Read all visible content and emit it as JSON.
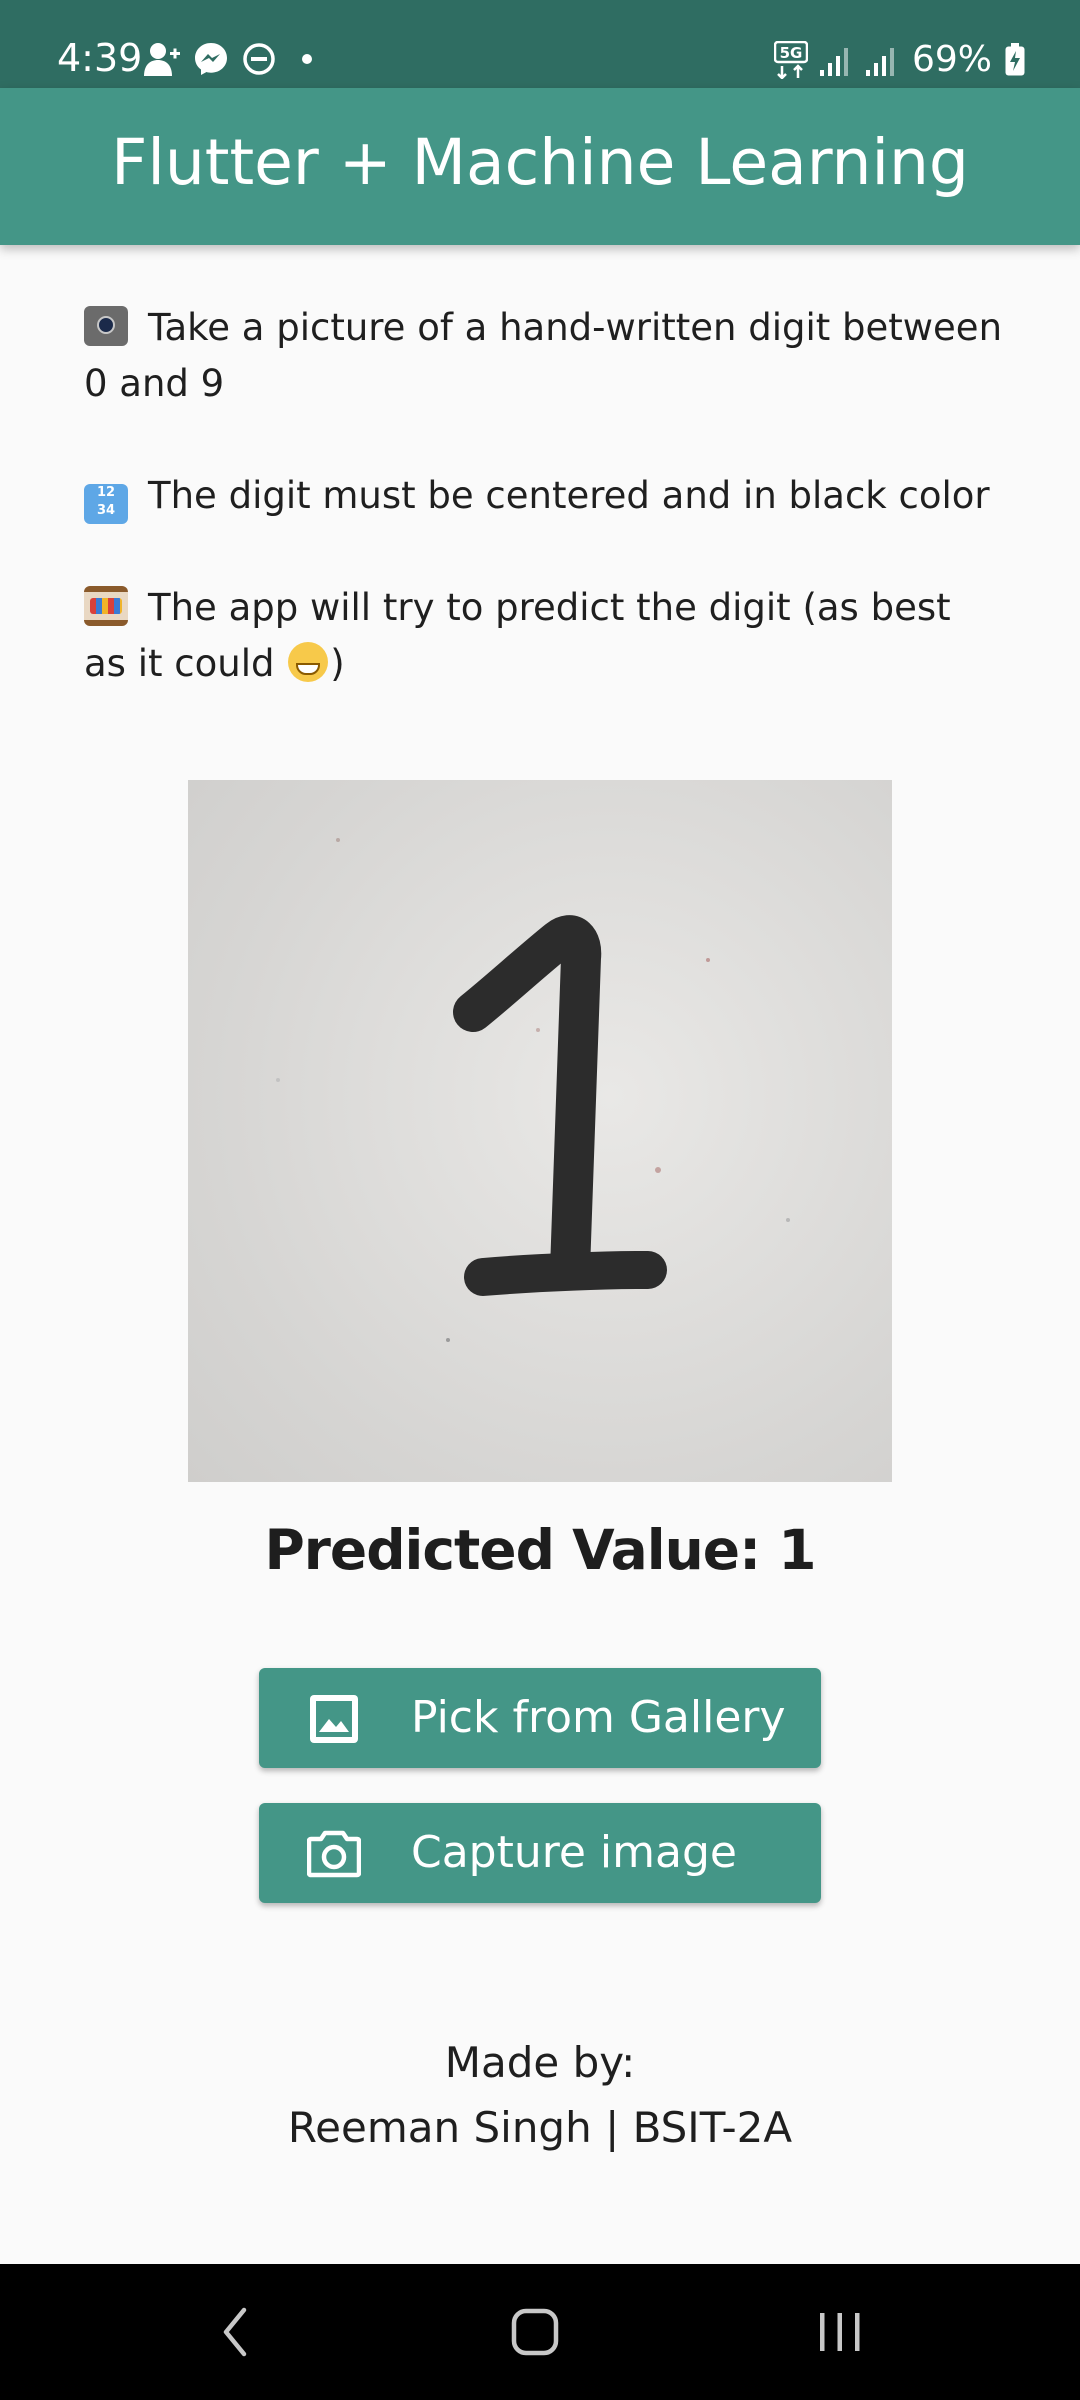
{
  "status_bar": {
    "time": "4:39",
    "network": "5G",
    "battery": "69%",
    "icons": [
      "add-person-icon",
      "messenger-icon",
      "do-not-disturb-icon",
      "notification-dot-icon",
      "5g-icon",
      "signal-icon",
      "signal-icon",
      "battery-charging-icon"
    ]
  },
  "app_bar": {
    "title": "Flutter + Machine Learning"
  },
  "instructions": [
    {
      "icon": "camera-emoji",
      "text": "Take a picture of a hand-written digit between 0 and 9"
    },
    {
      "icon": "numbers-emoji",
      "text": "The digit must be centered and in black color"
    },
    {
      "icon": "abacus-emoji",
      "text_before": "The app will try to predict the digit (as best as it could ",
      "icon_after": "grinning-emoji",
      "text_after": ")"
    }
  ],
  "image": {
    "description_icon": "handwritten-digit-photo"
  },
  "prediction": {
    "text": "Predicted Value: 1"
  },
  "buttons": {
    "gallery": {
      "label": "Pick from Gallery",
      "icon": "image-icon"
    },
    "capture": {
      "label": "Capture image",
      "icon": "camera-icon"
    }
  },
  "footer": {
    "line1": "Made by:",
    "line2": "Reeman Singh | BSIT-2A"
  },
  "nav_bar": {
    "icons": [
      "back-icon",
      "home-icon",
      "recent-apps-icon"
    ]
  },
  "colors": {
    "status_bar": "#2f6d62",
    "app_bar": "#449687",
    "button": "#449687",
    "background": "#fafafa",
    "nav_bar": "#000000"
  }
}
